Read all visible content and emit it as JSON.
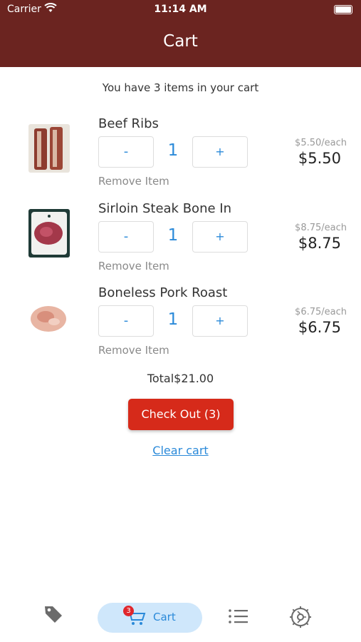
{
  "status_bar": {
    "carrier": "Carrier",
    "time": "11:14 AM"
  },
  "header": {
    "title": "Cart"
  },
  "cart": {
    "summary": "You have 3 items in your cart",
    "remove_label": "Remove Item",
    "minus_label": "-",
    "plus_label": "+",
    "items": [
      {
        "name": "Beef Ribs",
        "qty": "1",
        "each": "$5.50/each",
        "price": "$5.50",
        "image": "beef-ribs-photo"
      },
      {
        "name": "Sirloin Steak Bone In",
        "qty": "1",
        "each": "$8.75/each",
        "price": "$8.75",
        "image": "sirloin-steak-photo"
      },
      {
        "name": "Boneless Pork Roast",
        "qty": "1",
        "each": "$6.75/each",
        "price": "$6.75",
        "image": "pork-roast-photo"
      }
    ],
    "total": "Total$21.00",
    "checkout_label": "Check Out (3)",
    "clear_label": "Clear cart"
  },
  "tabbar": {
    "items": [
      {
        "icon": "tag-icon"
      },
      {
        "icon": "cart-icon",
        "label": "Cart",
        "badge": "3",
        "active": true
      },
      {
        "icon": "list-icon"
      },
      {
        "icon": "settings-icon"
      }
    ]
  },
  "colors": {
    "header_bg": "#6b2420",
    "accent_blue": "#2b8ad9",
    "checkout_red": "#d62a1a",
    "active_tab_bg": "#cfe7fb"
  }
}
